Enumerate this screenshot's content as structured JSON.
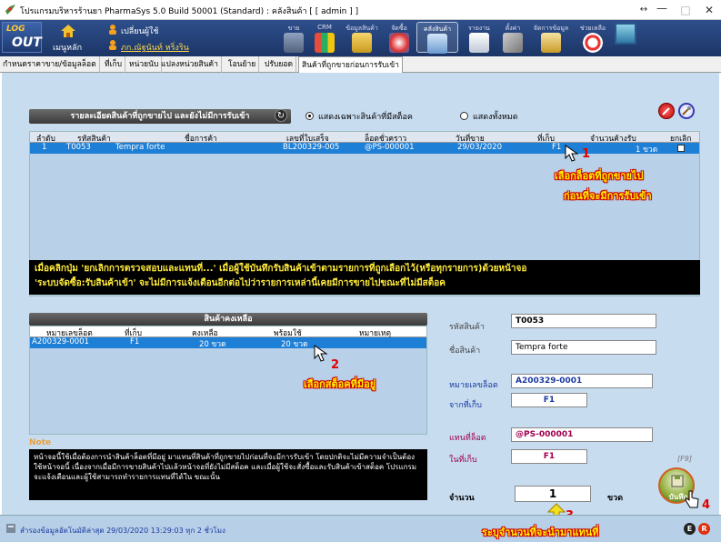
{
  "window": {
    "title": "โปรแกรมบริหารร้านยา PharmaSys 5.0 Build 50001 (Standard) : คลังสินค้า  [ [ admin ] ]",
    "btn_min": "—",
    "btn_max": "□",
    "btn_close": "✕",
    "btn_arrows": "↔"
  },
  "toolbar": {
    "logout_top": "LOG",
    "logout_bottom": "OUT",
    "home_label": "เมนูหลัก",
    "change_user_label": "เปลี่ยนผู้ใช้",
    "user_name": "ภก.ณัฐนันท์ หริ่งริน",
    "items": [
      "ขาย",
      "CRM",
      "ข้อมูลสินค้า",
      "จัดซื้อ",
      "คลังสินค้า",
      "รายงาน",
      "ตั้งค่า",
      "จัดการข้อมูล",
      "ช่วยเหลือ"
    ]
  },
  "tabs": [
    "กำหนดราคาขาย/ข้อมูลล็อต",
    "ที่เก็บ",
    "หน่วยนับ",
    "แปลงหน่วยสินค้า",
    "โอนย้าย",
    "ปรับยอด",
    "สินค้าที่ถูกขายก่อนการรับเข้า"
  ],
  "section1": {
    "title": "รายละเอียดสินค้าที่ถูกขายไป และยังไม่มีการรับเข้า",
    "radio_stock": "แสดงเฉพาะสินค้าที่มีสต็อค",
    "radio_all": "แสดงทั้งหมด",
    "columns": [
      "ลำดับ",
      "รหัสสินค้า",
      "ชื่อการค้า",
      "เลขที่ใบเสร็จ",
      "ล็อตชั่วคราว",
      "วันที่ขาย",
      "ที่เก็บ",
      "จำนวนค้างรับ",
      "ยกเลิก"
    ],
    "row": [
      "1",
      "T0053",
      "Tempra forte",
      "BL200329-005",
      "@PS-000001",
      "29/03/2020",
      "F1",
      "1 ขวด"
    ]
  },
  "annotation1": [
    "เลือกล็อตที่ถูกขายไป",
    "ก่อนที่จะมีการรับเข้า"
  ],
  "black_message": [
    "เมื่อคลิกปุ่ม 'ยกเลิกการตรวจสอบและแทนที่...' เมื่อผู้ใช้บันทึกรับสินค้าเข้าตามรายการที่ถูกเลือกไว้(หรือทุกรายการ)ด้วยหน้าจอ",
    "'ระบบจัดซื้อ:รับสินค้าเข้า' จะไม่มีการแจ้งเตือนอีกต่อไปว่ารายการเหล่านี้เคยมีการขายไปขณะที่ไม่มีสต็อค"
  ],
  "section2": {
    "title": "สินค้าคงเหลือ",
    "columns": [
      "หมายเลขล็อต",
      "ที่เก็บ",
      "คงเหลือ",
      "พร้อมใช้",
      "หมายเหตุ"
    ],
    "row": [
      "A200329-0001",
      "F1",
      "20 ขวด",
      "20 ขวด",
      ""
    ]
  },
  "annotation2": "เลือกสต็อคที่มีอยู่",
  "note": {
    "title": "Note",
    "text": "หน้าจอนี้ใช้เมื่อต้องการนำสินค้าล็อตที่มีอยู่ มาแทนที่สินค้าที่ถูกขายไปก่อนที่จะมีการรับเข้า โดยปกติจะไม่มีความจำเป็นต้องใช้หน้าจอนี้ เนื่องจากเมื่อมีการขายสินค้าไปแล้วหน้าจอที่ยังไม่มีสต็อค และเมื่อผู้ใช้จะสั่งซื้อและรับสินค้าเข้าสต็อค โปรแกรมจะแจ้งเตือนและผู้ใช้สามารถทำรายการแทนที่ได้ใน ขณะนั้น"
  },
  "form": {
    "product_code_label": "รหัสสินค้า",
    "product_code": "T0053",
    "product_name_label": "ชื่อสินค้า",
    "product_name": "Tempra forte",
    "lot_label": "หมายเลขล็อต",
    "lot": "A200329-0001",
    "from_loc_label": "จากที่เก็บ",
    "from_loc": "F1",
    "replace_label": "แทนที่ล็อต",
    "replace_lot": "@PS-000001",
    "in_loc_label": "ในที่เก็บ",
    "in_loc": "F1",
    "qty_label": "จำนวน",
    "qty": "1",
    "unit": "ขวด",
    "f9": "[F9]",
    "save_label": "บันทึก"
  },
  "annotation3": "ระบุจำนวนที่จะนำมาแทนที่",
  "marks": [
    "1",
    "2",
    "3",
    "4"
  ],
  "status": {
    "text": "สำรองข้อมูลอัตโนมัติล่าสุด  29/03/2020 13:29:03  ทุก 2 ชั่วโมง"
  },
  "colors": {
    "selection": "#1e7fd6",
    "panel_bg": "#c8dcf0",
    "annotation": "#ffee00",
    "marker": "#e00000"
  }
}
